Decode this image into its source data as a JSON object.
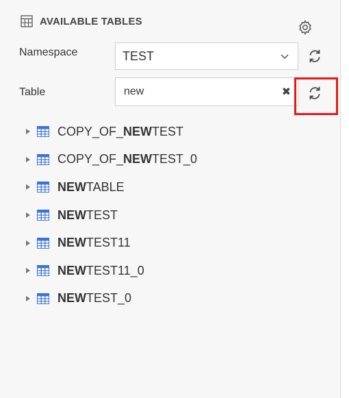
{
  "header": {
    "title": "AVAILABLE TABLES"
  },
  "namespace": {
    "label": "Namespace",
    "value": "TEST"
  },
  "table": {
    "label": "Table",
    "value": "new"
  },
  "clear_glyph": "✖",
  "tree": [
    {
      "prefix": "COPY_OF_",
      "match": "NEW",
      "suffix": "TEST"
    },
    {
      "prefix": "COPY_OF_",
      "match": "NEW",
      "suffix": "TEST_0"
    },
    {
      "prefix": "",
      "match": "NEW",
      "suffix": "TABLE"
    },
    {
      "prefix": "",
      "match": "NEW",
      "suffix": "TEST"
    },
    {
      "prefix": "",
      "match": "NEW",
      "suffix": "TEST11"
    },
    {
      "prefix": "",
      "match": "NEW",
      "suffix": "TEST11_0"
    },
    {
      "prefix": "",
      "match": "NEW",
      "suffix": "TEST_0"
    }
  ],
  "colors": {
    "accent_blue": "#3b73d6",
    "highlight_red": "#e8161a"
  }
}
